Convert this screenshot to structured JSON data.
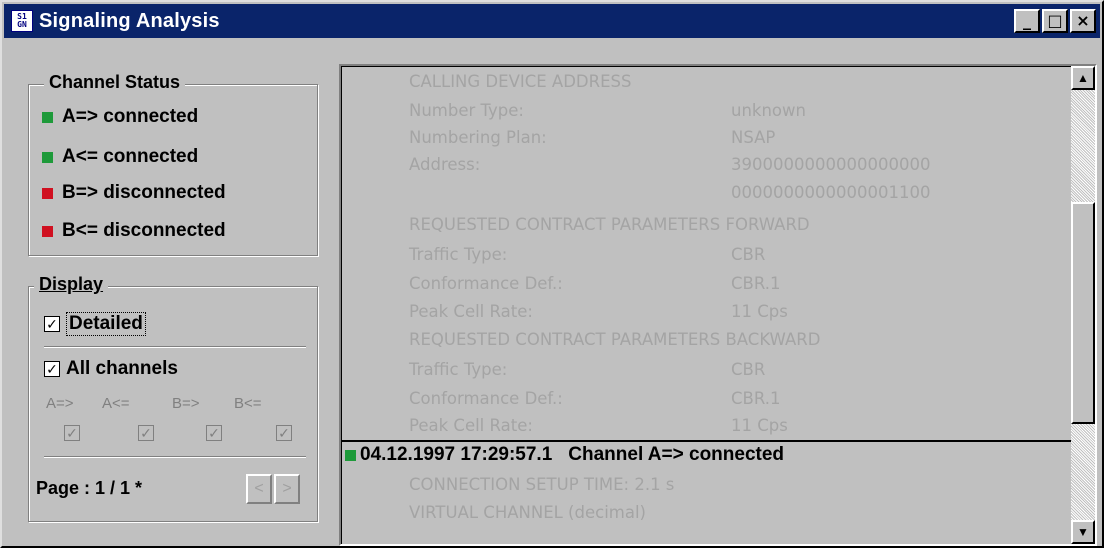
{
  "window": {
    "title": "Signaling Analysis",
    "icon_text_top": "S1",
    "icon_text_bottom": "GN",
    "minimize_label": "_",
    "maximize_label": "□",
    "close_label": "×"
  },
  "channel_status": {
    "title": "Channel Status",
    "items": [
      {
        "label": "A=> connected",
        "color": "#1e9a3a"
      },
      {
        "label": "A<= connected",
        "color": "#1e9a3a"
      },
      {
        "label": "B=> disconnected",
        "color": "#d01020"
      },
      {
        "label": "B<= disconnected",
        "color": "#d01020"
      }
    ]
  },
  "display": {
    "title": "Display",
    "detailed_label": "Detailed",
    "detailed_checked": "✓",
    "all_channels_label": "All channels",
    "all_channels_checked": "✓",
    "channels": [
      "A=>",
      "A<=",
      "B=>",
      "B<="
    ],
    "channel_check": "✓",
    "page_label": "Page : 1 / 1 *",
    "prev_label": "<",
    "next_label": ">"
  },
  "log": {
    "lines": [
      {
        "label": "CALLING DEVICE ADDRESS",
        "value": ""
      },
      {
        "label": "Number Type:",
        "value": "unknown"
      },
      {
        "label": "Numbering Plan:",
        "value": "NSAP"
      },
      {
        "label": "Address:",
        "value": "3900000000000000000"
      },
      {
        "label": "",
        "value": "0000000000000001100"
      },
      {
        "label": "REQUESTED CONTRACT PARAMETERS FORWARD",
        "value": ""
      },
      {
        "label": "Traffic Type:",
        "value": "CBR"
      },
      {
        "label": "Conformance Def.:",
        "value": "CBR.1"
      },
      {
        "label": "Peak Cell Rate:",
        "value": "11 Cps"
      },
      {
        "label": "REQUESTED CONTRACT PARAMETERS BACKWARD",
        "value": ""
      },
      {
        "label": "Traffic Type:",
        "value": "CBR"
      },
      {
        "label": "Conformance Def.:",
        "value": "CBR.1"
      },
      {
        "label": "Peak Cell Rate:",
        "value": "11 Cps"
      }
    ],
    "event": {
      "timestamp": "04.12.1997 17:29:57.1",
      "message": "Channel A=> connected",
      "color": "#1e9a3a"
    },
    "after_lines": [
      {
        "label": "CONNECTION SETUP TIME: 2.1 s",
        "value": ""
      },
      {
        "label": "VIRTUAL CHANNEL (decimal)",
        "value": ""
      }
    ],
    "scroll_up": "▲",
    "scroll_down": "▼"
  }
}
